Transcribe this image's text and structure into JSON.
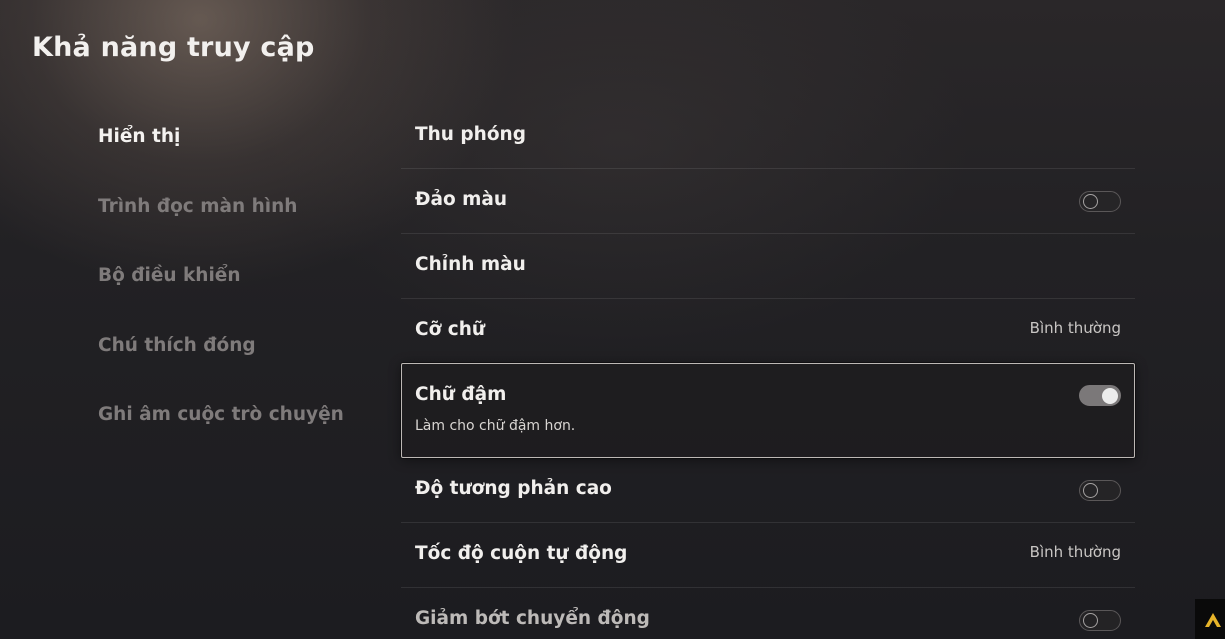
{
  "page": {
    "title": "Khả năng truy cập"
  },
  "sidebar": {
    "items": [
      {
        "label": "Hiển thị",
        "active": true
      },
      {
        "label": "Trình đọc màn hình",
        "active": false
      },
      {
        "label": "Bộ điều khiển",
        "active": false
      },
      {
        "label": "Chú thích đóng",
        "active": false
      },
      {
        "label": "Ghi âm cuộc trò chuyện",
        "active": false
      }
    ]
  },
  "settings": {
    "zoom": {
      "label": "Thu phóng"
    },
    "invert_colors": {
      "label": "Đảo màu",
      "toggle": "off"
    },
    "color_correction": {
      "label": "Chỉnh màu"
    },
    "text_size": {
      "label": "Cỡ chữ",
      "value": "Bình thường"
    },
    "bold_text": {
      "label": "Chữ đậm",
      "description": "Làm cho chữ đậm hơn.",
      "toggle": "on"
    },
    "high_contrast": {
      "label": "Độ tương phản cao",
      "toggle": "off"
    },
    "auto_scroll_speed": {
      "label": "Tốc độ cuộn tự động",
      "value": "Bình thường"
    },
    "reduce_motion": {
      "label": "Giảm bớt chuyển động",
      "toggle": "off"
    }
  },
  "colors": {
    "background": "#1c1c20",
    "focus_border": "#bdb8b5",
    "toggle_on": "#7b7879",
    "active_text": "#f4f2f0",
    "inactive_text": "#7f7b7b"
  }
}
